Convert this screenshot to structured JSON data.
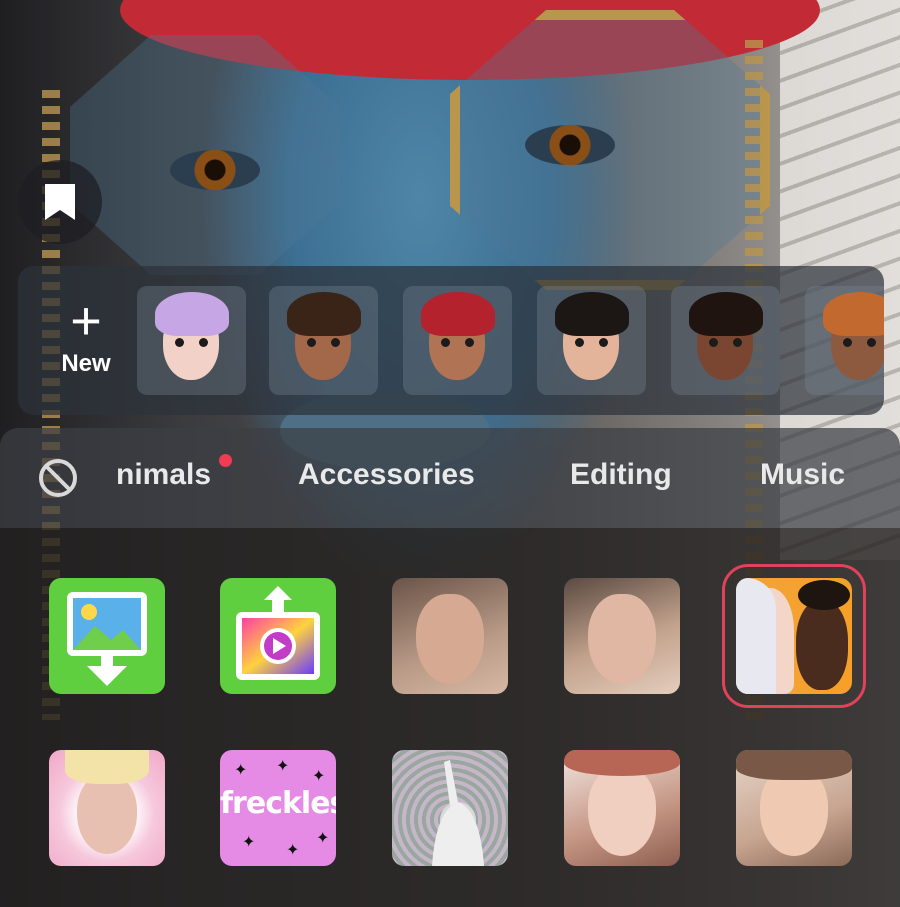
{
  "avatar_strip": {
    "new_label": "New",
    "avatars": [
      {
        "name": "avatar-purple-hair",
        "skin": "#f2d1c8",
        "hair": "#c7a6e6"
      },
      {
        "name": "avatar-curly-brown",
        "skin": "#a3674a",
        "hair": "#3a2418"
      },
      {
        "name": "avatar-red-beanie",
        "skin": "#b07455",
        "hair": "#b3222d"
      },
      {
        "name": "avatar-dark-hair",
        "skin": "#e4b49a",
        "hair": "#1c1614"
      },
      {
        "name": "avatar-afro",
        "skin": "#7a4631",
        "hair": "#1f1410"
      },
      {
        "name": "avatar-hijab",
        "skin": "#8d5a3f",
        "hair": "#c1692f"
      }
    ]
  },
  "categories": {
    "tabs": [
      "nimals",
      "Accessories",
      "Editing",
      "Music"
    ],
    "has_new_dot": true,
    "dot_color": "#f03b55"
  },
  "effects": {
    "row1": [
      "green-screen-photo",
      "green-screen-video",
      "face-effect-1",
      "face-effect-2",
      "avatar-duo"
    ],
    "row2": [
      "hello-kitty-effect",
      "freckles-effect",
      "dancing-silhouette-effect",
      "flower-crown-effect",
      "natural-face-effect"
    ],
    "freckles_text": "freckles",
    "selected": "avatar-duo",
    "selected_color": "#e2415a"
  }
}
